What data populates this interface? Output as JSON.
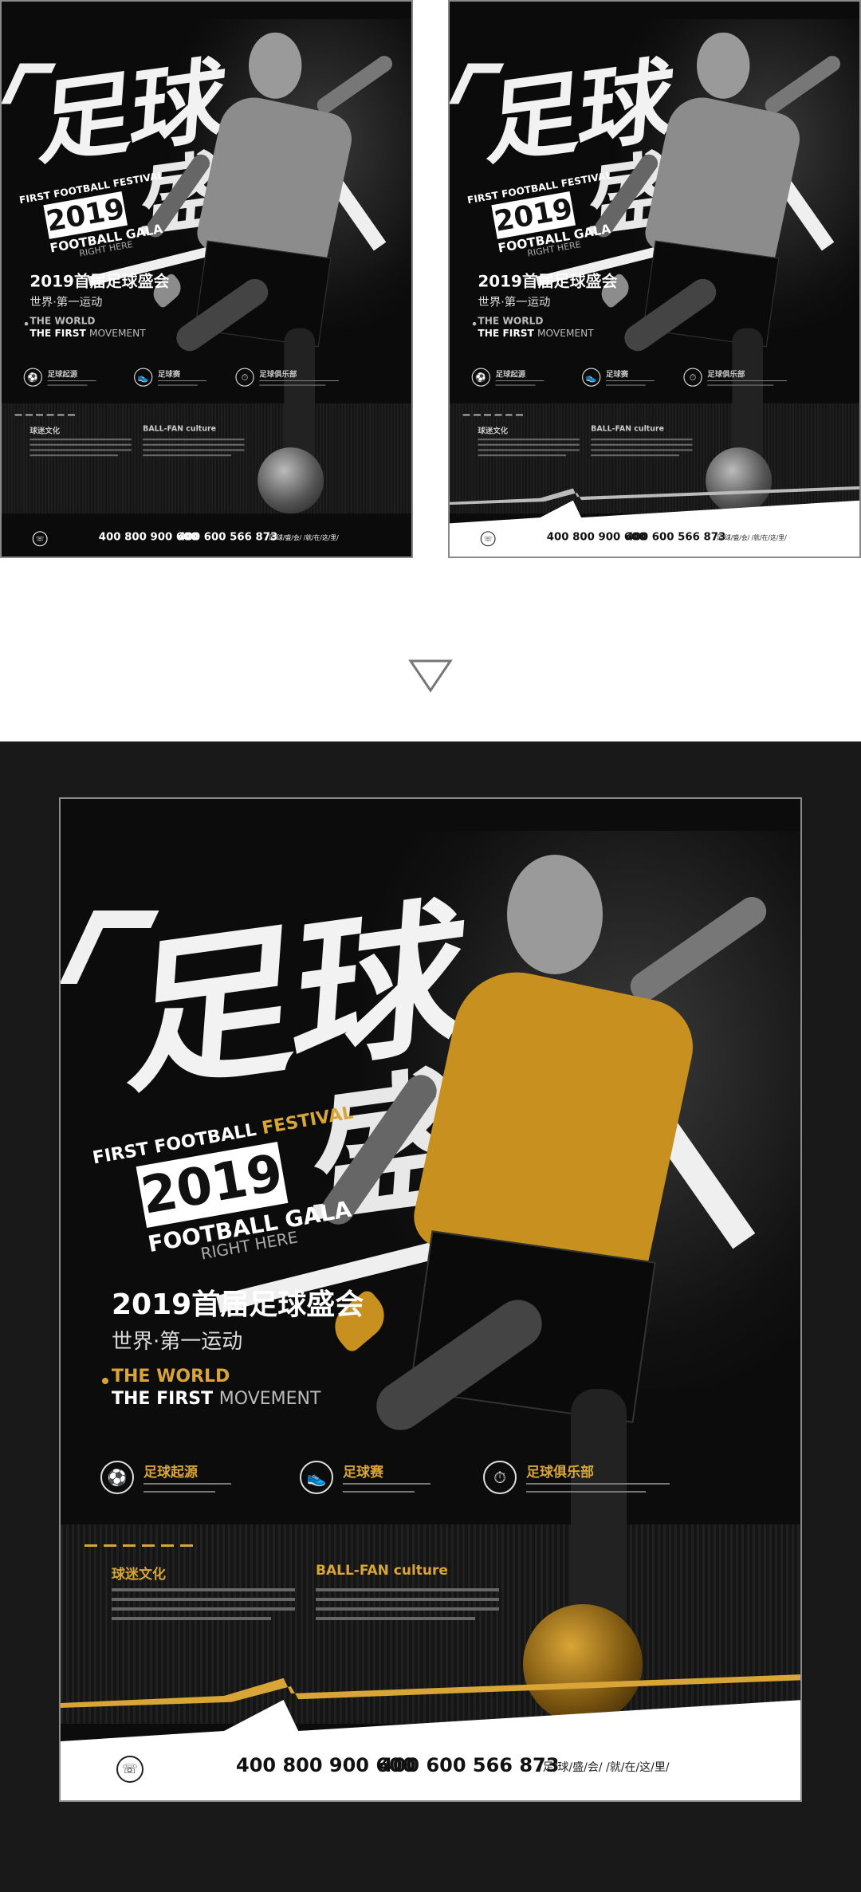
{
  "poster": {
    "title_line1": "足球",
    "title_line2": "盛会",
    "festival_prefix": "FIRST FOOTBALL",
    "festival_word": "FESTIVAL",
    "year": "2019",
    "gala": "FOOTBALL GALA",
    "right_here": "RIGHT HERE",
    "headline": "2019首届足球盛会",
    "subline": "世界·第一运动",
    "world_line1": "THE WORLD",
    "world_line2_bold": "THE FIRST",
    "world_line2_light": "MOVEMENT",
    "features": [
      {
        "label": "足球起源",
        "icon": "soccer-ball-icon"
      },
      {
        "label": "足球赛",
        "icon": "boot-icon"
      },
      {
        "label": "足球俱乐部",
        "icon": "stopwatch-icon"
      }
    ],
    "section1_title": "球迷文化",
    "section2_title": "BALL-FAN culture",
    "phone1": "400 800 900 600",
    "phone2": "400 600 566 873",
    "slogan": "/足/球/盛/会/   /就/在/这/里/"
  },
  "colors": {
    "accent": "#d9a536",
    "background": "#0c0c0c",
    "frame": "#191919"
  }
}
